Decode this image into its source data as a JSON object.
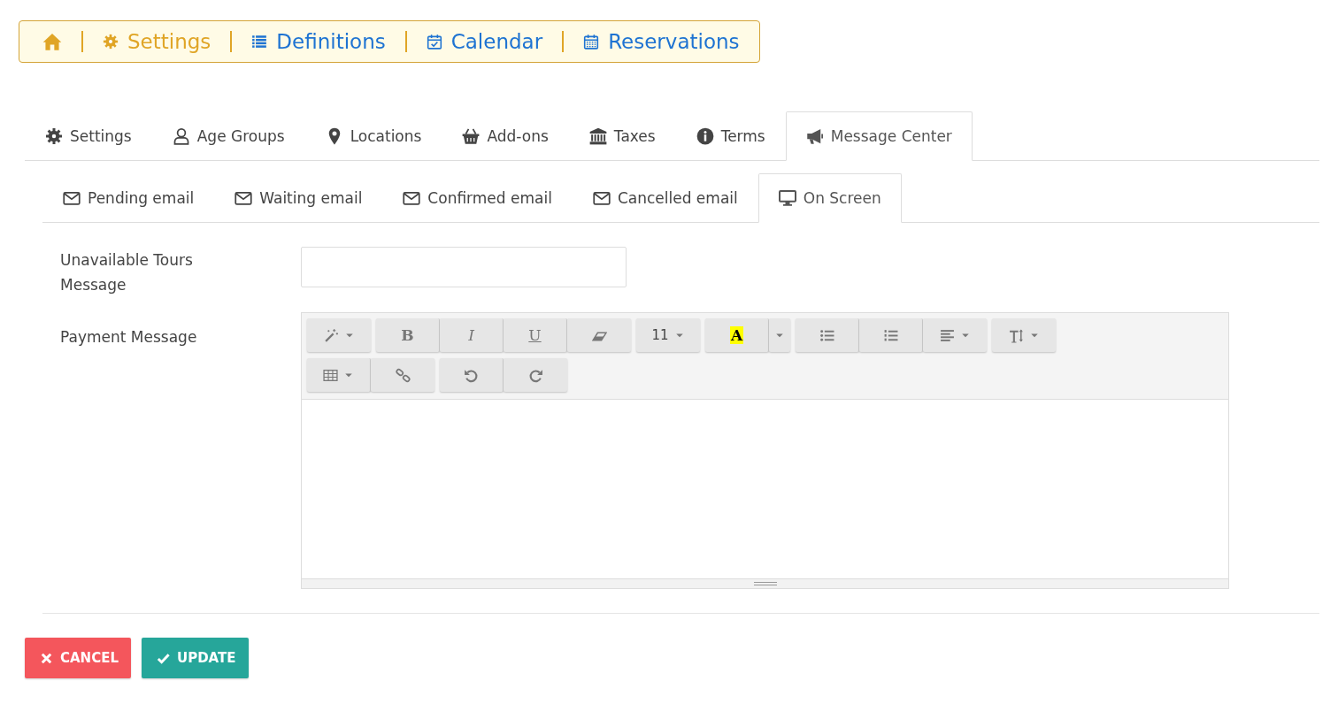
{
  "breadcrumb": [
    {
      "label": "Settings",
      "color": "#e0a526"
    },
    {
      "label": "Definitions",
      "color": "#1e73d2"
    },
    {
      "label": "Calendar",
      "color": "#1e73d2"
    },
    {
      "label": "Reservations",
      "color": "#1e73d2"
    }
  ],
  "tabs": [
    {
      "label": "Settings",
      "selected": false
    },
    {
      "label": "Age Groups",
      "selected": false
    },
    {
      "label": "Locations",
      "selected": false
    },
    {
      "label": "Add-ons",
      "selected": false
    },
    {
      "label": "Taxes",
      "selected": false
    },
    {
      "label": "Terms",
      "selected": false
    },
    {
      "label": "Message Center",
      "selected": true
    }
  ],
  "subtabs": [
    {
      "label": "Pending email",
      "selected": false
    },
    {
      "label": "Waiting email",
      "selected": false
    },
    {
      "label": "Confirmed email",
      "selected": false
    },
    {
      "label": "Cancelled email",
      "selected": false
    },
    {
      "label": "On Screen",
      "selected": true
    }
  ],
  "form": {
    "unavailable_label": "Unavailable Tours Message",
    "payment_label": "Payment Message"
  },
  "toolbar": {
    "bold": "B",
    "italic": "I",
    "underline": "U",
    "font_size": "11",
    "text_color_letter": "A"
  },
  "buttons": [
    {
      "kind": "cancel",
      "label": "CANCEL"
    },
    {
      "kind": "update",
      "label": "UPDATE"
    }
  ]
}
